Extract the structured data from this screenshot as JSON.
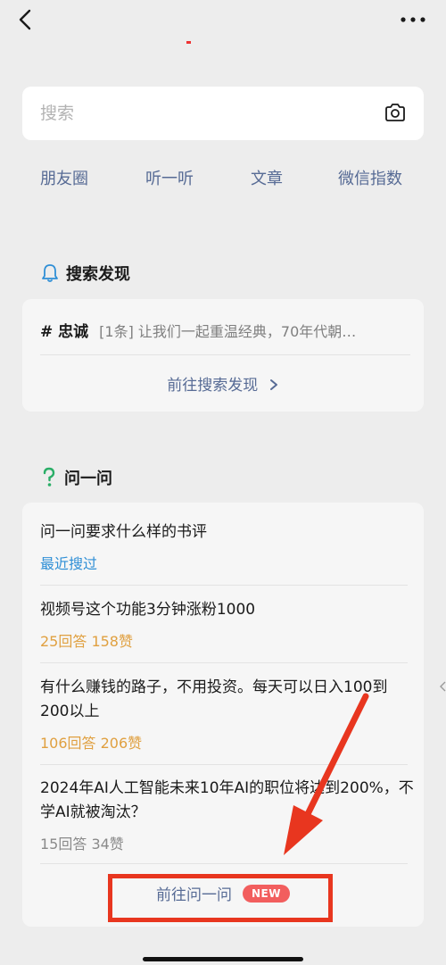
{
  "search": {
    "placeholder": "搜索"
  },
  "quick_links": [
    "朋友圈",
    "听一听",
    "文章",
    "微信指数"
  ],
  "discover": {
    "title": "搜索发现",
    "topic_tag": "# 忠诚",
    "topic_text": "[1条] 让我们一起重温经典，70年代朝…",
    "goto_label": "前往搜索发现"
  },
  "ask": {
    "title": "问一问",
    "items": [
      {
        "title": "问一问要求什么样的书评",
        "meta": "最近搜过",
        "meta_color": "#2f8fd6"
      },
      {
        "title": "视频号这个功能3分钟涨粉1000",
        "meta": "25回答  158赞",
        "meta_color": "#e0a040"
      },
      {
        "title": "有什么赚钱的路子，不用投资。每天可以日入100到200以上",
        "meta": "106回答  206赞",
        "meta_color": "#e0a040"
      },
      {
        "title": "2024年AI人工智能未来10年AI的职位将达到200%，不学AI就被淘汰？",
        "meta": "15回答  34赞",
        "meta_color": "#8a8a8a"
      }
    ],
    "goto_label": "前往问一问",
    "badge": "NEW"
  },
  "colors": {
    "link": "#576b95",
    "highlight": "#e8361f",
    "new_badge": "#f25e5e",
    "recent": "#2f8fd6",
    "stats": "#e0a040"
  }
}
